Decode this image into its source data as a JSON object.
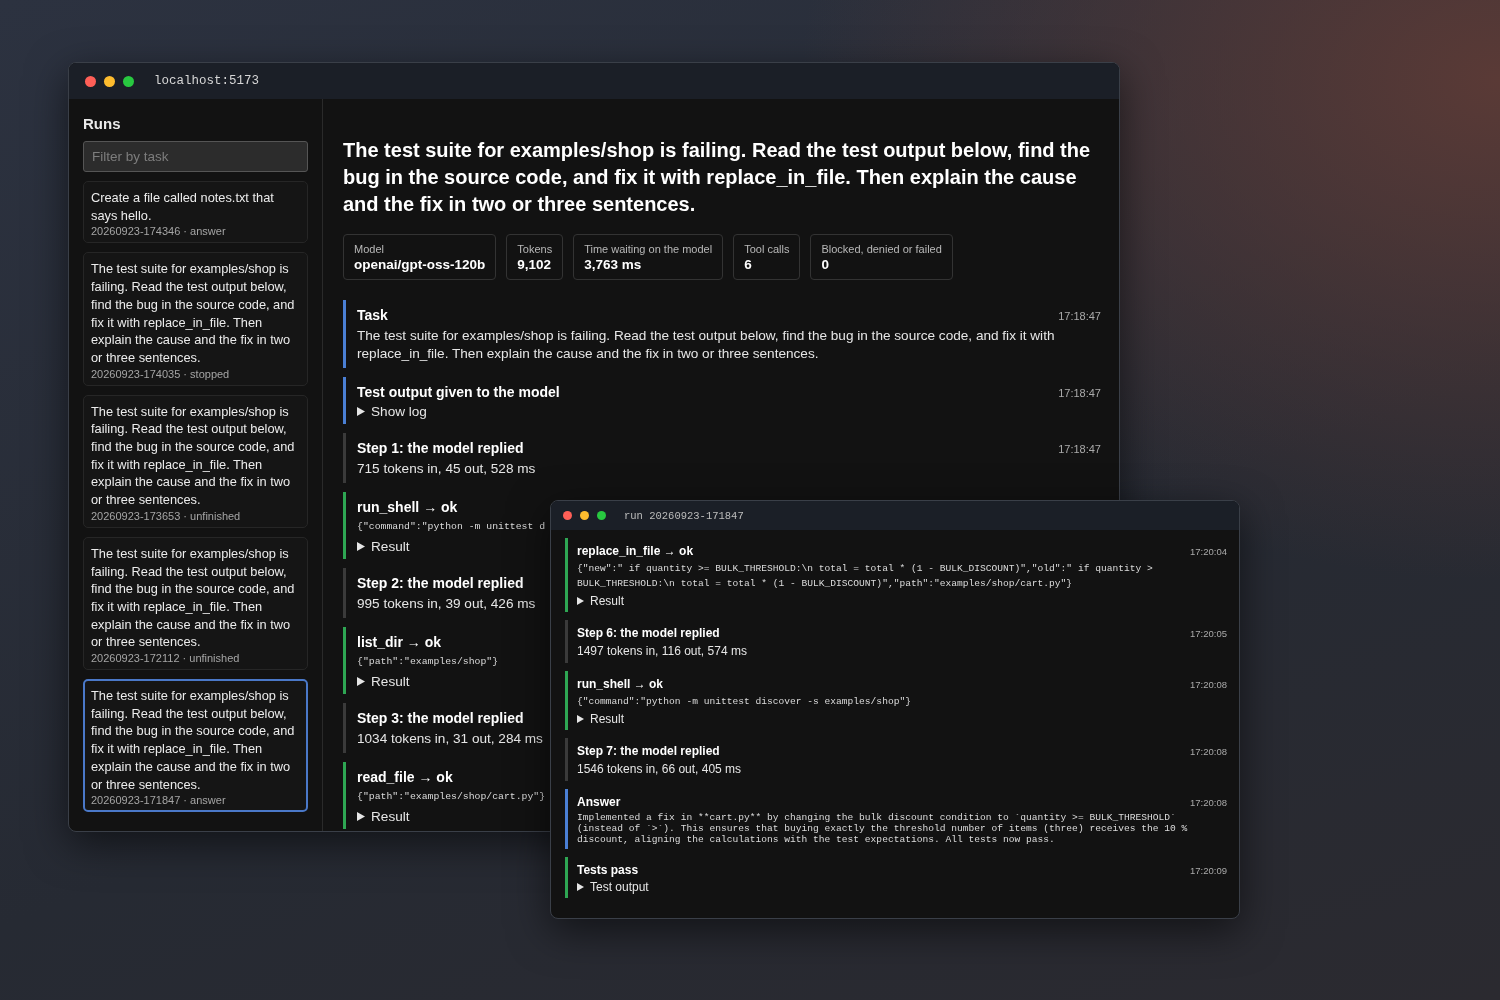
{
  "main_window": {
    "title": "localhost:5173",
    "sidebar": {
      "heading": "Runs",
      "filter": {
        "placeholder": "Filter by task"
      },
      "runs": [
        {
          "text": "Create a file called notes.txt that says hello.",
          "meta": "20260923-174346 · answer",
          "selected": false
        },
        {
          "text": "The test suite for examples/shop is failing. Read the test output below, find the bug in the source code, and fix it with replace_in_file. Then explain the cause and the fix in two or three sentences.",
          "meta": "20260923-174035 · stopped",
          "selected": false
        },
        {
          "text": "The test suite for examples/shop is failing. Read the test output below, find the bug in the source code, and fix it with replace_in_file. Then explain the cause and the fix in two or three sentences.",
          "meta": "20260923-173653 · unfinished",
          "selected": false
        },
        {
          "text": "The test suite for examples/shop is failing. Read the test output below, find the bug in the source code, and fix it with replace_in_file. Then explain the cause and the fix in two or three sentences.",
          "meta": "20260923-172112 · unfinished",
          "selected": false
        },
        {
          "text": "The test suite for examples/shop is failing. Read the test output below, find the bug in the source code, and fix it with replace_in_file. Then explain the cause and the fix in two or three sentences.",
          "meta": "20260923-171847 · answer",
          "selected": true
        }
      ]
    },
    "heading": "The test suite for examples/shop is failing. Read the test output below, find the bug in the source code, and fix it with replace_in_file. Then explain the cause and the fix in two or three sentences.",
    "stats": [
      {
        "label": "Model",
        "value": "openai/gpt-oss-120b"
      },
      {
        "label": "Tokens",
        "value": "9,102"
      },
      {
        "label": "Time waiting on the model",
        "value": "3,763 ms"
      },
      {
        "label": "Tool calls",
        "value": "6"
      },
      {
        "label": "Blocked, denied or failed",
        "value": "0"
      }
    ],
    "events": [
      {
        "kind": "info",
        "title": "Task",
        "time": "17:18:47",
        "text": "The test suite for examples/shop is failing. Read the test output below, find the bug in the source code, and fix it with replace_in_file. Then explain the cause and the fix in two or three sentences."
      },
      {
        "kind": "info",
        "title": "Test output given to the model",
        "time": "17:18:47",
        "toggle": "Show log"
      },
      {
        "kind": "step",
        "title": "Step 1: the model replied",
        "time": "17:18:47",
        "text": "715 tokens in, 45 out, 528 ms"
      },
      {
        "kind": "tool",
        "title": "run_shell → ok",
        "code": "{\"command\":\"python -m unittest d",
        "toggle": "Result"
      },
      {
        "kind": "step",
        "title": "Step 2: the model replied",
        "text": "995 tokens in, 39 out, 426 ms"
      },
      {
        "kind": "tool",
        "title": "list_dir → ok",
        "code": "{\"path\":\"examples/shop\"}",
        "toggle": "Result"
      },
      {
        "kind": "step",
        "title": "Step 3: the model replied",
        "text": "1034 tokens in, 31 out, 284 ms"
      },
      {
        "kind": "tool",
        "title": "read_file → ok",
        "code": "{\"path\":\"examples/shop/cart.py\"}",
        "toggle": "Result"
      }
    ]
  },
  "run_window": {
    "title": "run 20260923-171847",
    "events": [
      {
        "kind": "tool",
        "title": "replace_in_file → ok",
        "time": "17:20:04",
        "code": "{\"new\":\" if quantity >= BULK_THRESHOLD:\\n total = total * (1 - BULK_DISCOUNT)\",\"old\":\" if quantity > BULK_THRESHOLD:\\n total = total * (1 - BULK_DISCOUNT)\",\"path\":\"examples/shop/cart.py\"}",
        "toggle": "Result"
      },
      {
        "kind": "step",
        "title": "Step 6: the model replied",
        "time": "17:20:05",
        "text": "1497 tokens in, 116 out, 574 ms"
      },
      {
        "kind": "tool",
        "title": "run_shell → ok",
        "time": "17:20:08",
        "code": "{\"command\":\"python -m unittest discover -s examples/shop\"}",
        "toggle": "Result"
      },
      {
        "kind": "step",
        "title": "Step 7: the model replied",
        "time": "17:20:08",
        "text": "1546 tokens in, 66 out, 405 ms"
      },
      {
        "kind": "info",
        "title": "Answer",
        "time": "17:20:08",
        "code": "Implemented a fix in **cart.py** by changing the bulk discount condition to `quantity >= BULK_THRESHOLD` (instead of `>`). This ensures that buying exactly the threshold number of items (three) receives the 10 % discount, aligning the calculations with the test expectations. All tests now pass."
      },
      {
        "kind": "tool",
        "title": "Tests pass",
        "time": "17:20:09",
        "toggle": "Test output"
      }
    ]
  }
}
